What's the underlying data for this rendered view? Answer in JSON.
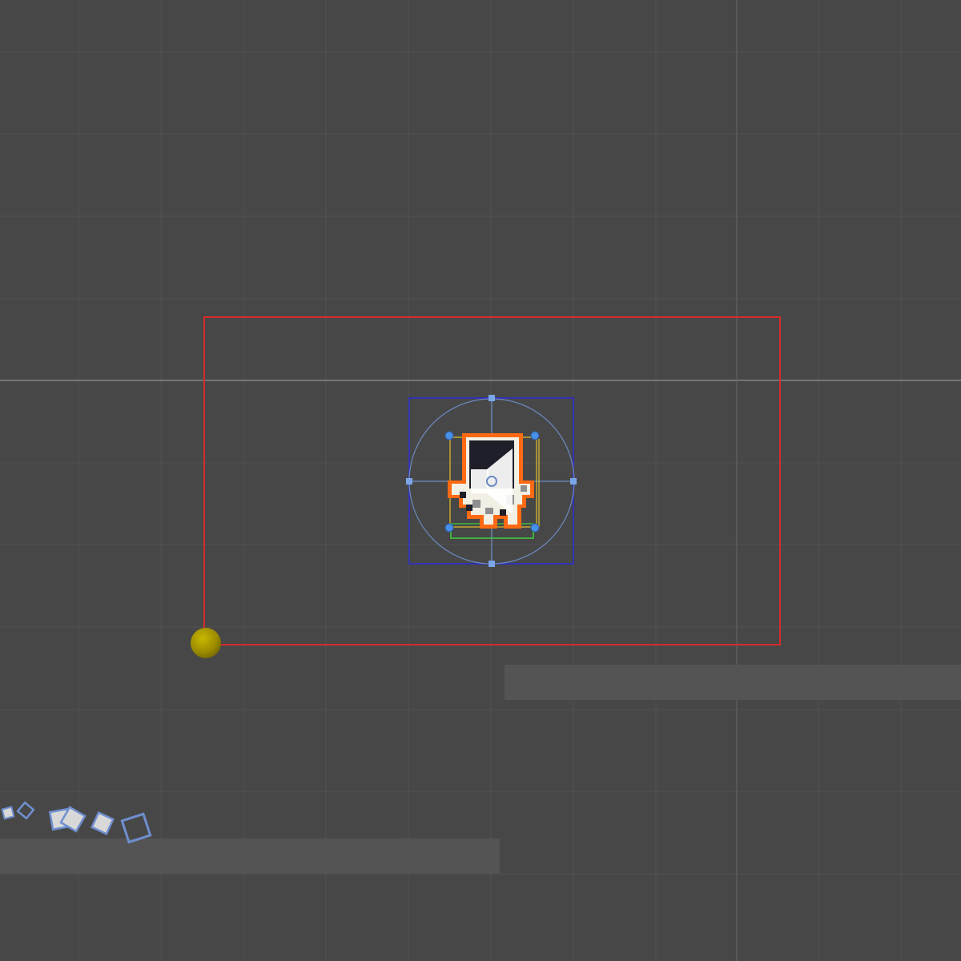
{
  "scene_view": {
    "background_color": "#474747",
    "grid": {
      "visible": true,
      "line_color": "#525252",
      "axis_color": "#8e8e8e"
    },
    "camera_bounds": {
      "color": "#d62b2b"
    },
    "selected_object": {
      "gizmo_icon": "speaker-icon",
      "outline_color": "#ff6a13",
      "rect_tool_color": "#2b2bd6",
      "handle_color": "#4a8fe6",
      "collider_color_yellow": "#e6c12b",
      "collider_color_green": "#3ccf3c"
    },
    "pivot_marker": {
      "color": "#a89a00"
    },
    "platforms": {
      "color": "#545454"
    },
    "particles": {
      "color": "#6f8fcf"
    }
  }
}
